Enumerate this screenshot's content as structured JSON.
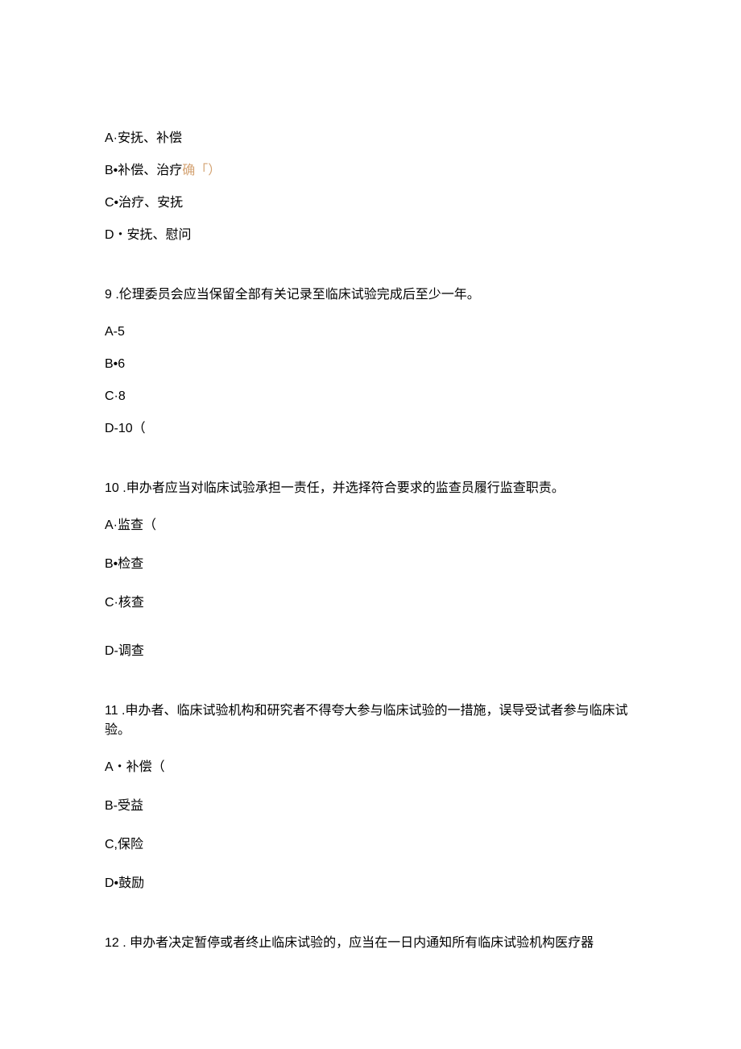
{
  "q8": {
    "optionA": "A·安抚、补偿",
    "optionB_prefix": "B•补偿、治疗",
    "optionB_highlight": "确「）",
    "optionC": "C•治疗、安抚",
    "optionD": "D・安抚、慰问"
  },
  "q9": {
    "question": "9 .伦理委员会应当保留全部有关记录至临床试验完成后至少一年。",
    "optionA": "A-5",
    "optionB": "B•6",
    "optionC": "C·8",
    "optionD": "D-10（"
  },
  "q10": {
    "question": "10 .申办者应当对临床试验承担一责任，并选择符合要求的监查员履行监查职责。",
    "optionA": "A·监查（",
    "optionB": "B•检查",
    "optionC": "C·核查",
    "optionD": "D-调查"
  },
  "q11": {
    "question": "11 .申办者、临床试验机构和研究者不得夸大参与临床试验的一措施，误导受试者参与临床试验。",
    "optionA": "A・补偿（",
    "optionB": "B-受益",
    "optionC": "C,保险",
    "optionD": "D•鼓励"
  },
  "q12": {
    "question": "12 . 申办者决定暂停或者终止临床试验的，应当在一日内通知所有临床试验机构医疗器"
  }
}
